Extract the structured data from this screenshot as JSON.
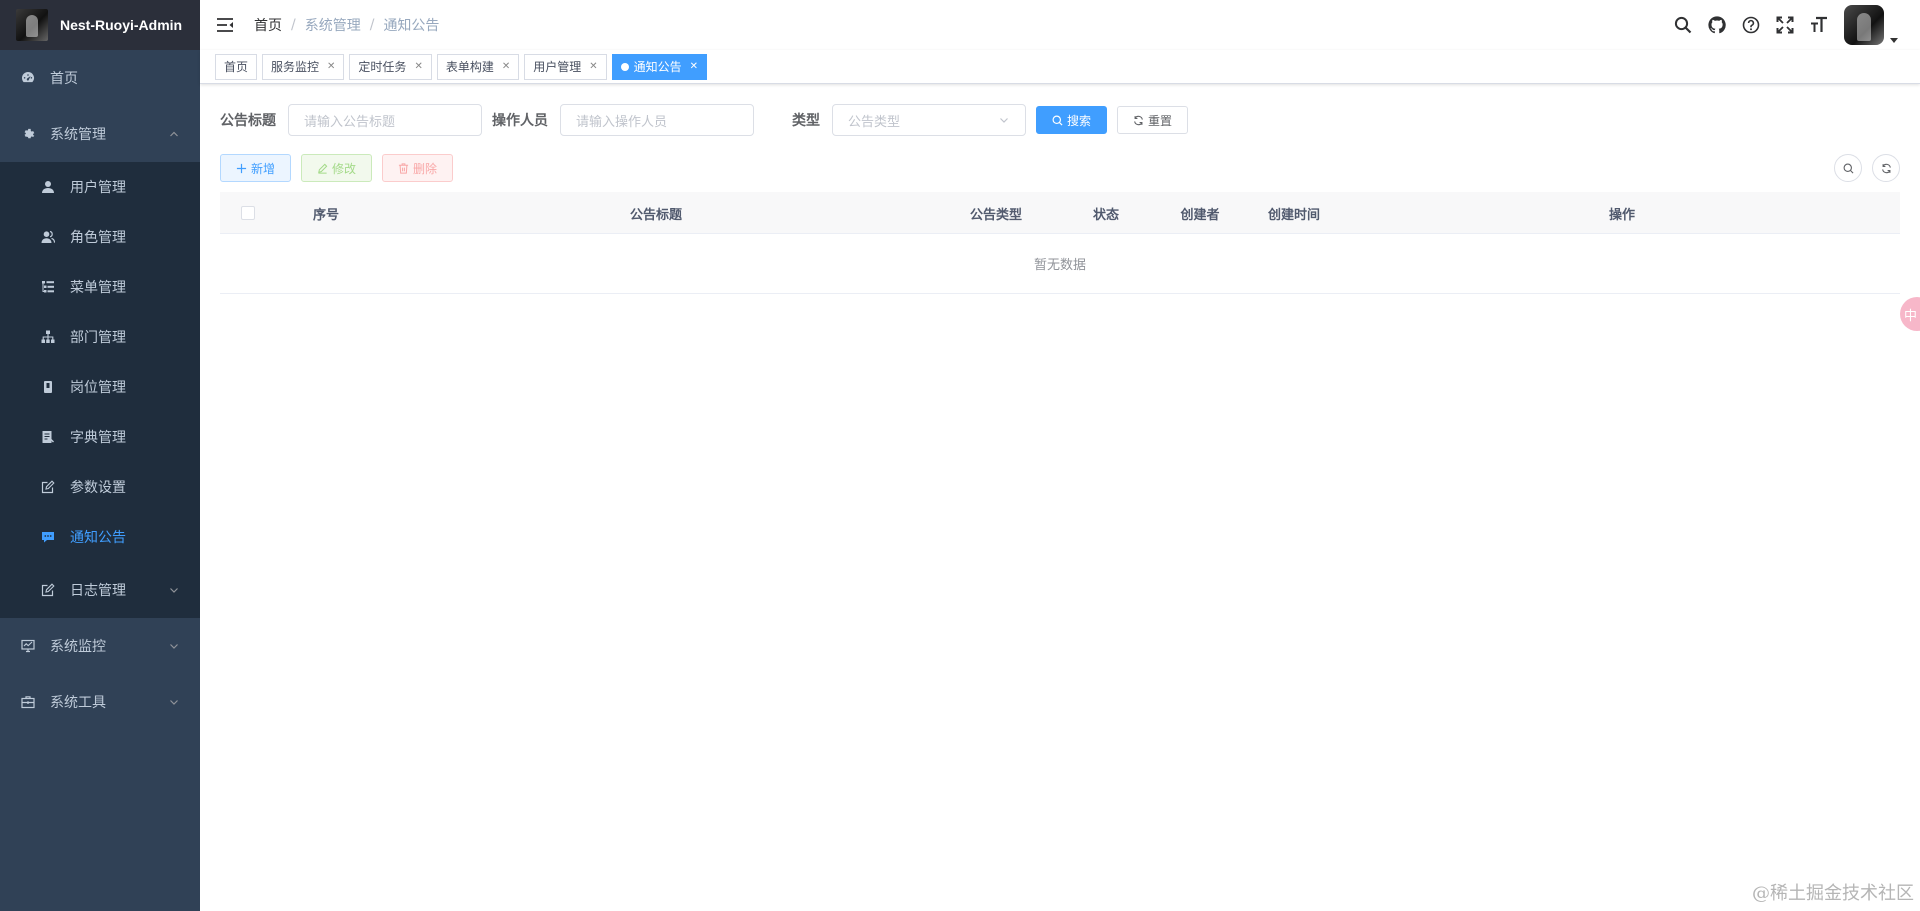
{
  "app": {
    "title": "Nest-Ruoyi-Admin"
  },
  "sidebar": {
    "home": "首页",
    "system": {
      "label": "系统管理",
      "items": [
        {
          "label": "用户管理",
          "icon": "user-icon"
        },
        {
          "label": "角色管理",
          "icon": "peoples-icon"
        },
        {
          "label": "菜单管理",
          "icon": "tree-table-icon"
        },
        {
          "label": "部门管理",
          "icon": "tree-icon"
        },
        {
          "label": "岗位管理",
          "icon": "post-icon"
        },
        {
          "label": "字典管理",
          "icon": "dict-icon"
        },
        {
          "label": "参数设置",
          "icon": "edit-icon"
        },
        {
          "label": "通知公告",
          "icon": "message-icon"
        },
        {
          "label": "日志管理",
          "icon": "log-icon"
        }
      ]
    },
    "monitor": "系统监控",
    "tool": "系统工具",
    "active_color": "#409eff"
  },
  "breadcrumb": [
    "首页",
    "系统管理",
    "通知公告"
  ],
  "tags": [
    {
      "label": "首页",
      "closable": false
    },
    {
      "label": "服务监控",
      "closable": true
    },
    {
      "label": "定时任务",
      "closable": true
    },
    {
      "label": "表单构建",
      "closable": true
    },
    {
      "label": "用户管理",
      "closable": true
    },
    {
      "label": "通知公告",
      "closable": true,
      "active": true
    }
  ],
  "search": {
    "title_label": "公告标题",
    "title_placeholder": "请输入公告标题",
    "operator_label": "操作人员",
    "operator_placeholder": "请输入操作人员",
    "type_label": "类型",
    "type_placeholder": "公告类型",
    "search_button": "搜索",
    "reset_button": "重置"
  },
  "toolbar": {
    "add": "新增",
    "edit": "修改",
    "delete": "删除"
  },
  "table": {
    "columns": [
      "序号",
      "公告标题",
      "公告类型",
      "状态",
      "创建者",
      "创建时间",
      "操作"
    ],
    "empty_text": "暂无数据"
  },
  "side_badge": "中",
  "watermark": "@稀土掘金技术社区"
}
